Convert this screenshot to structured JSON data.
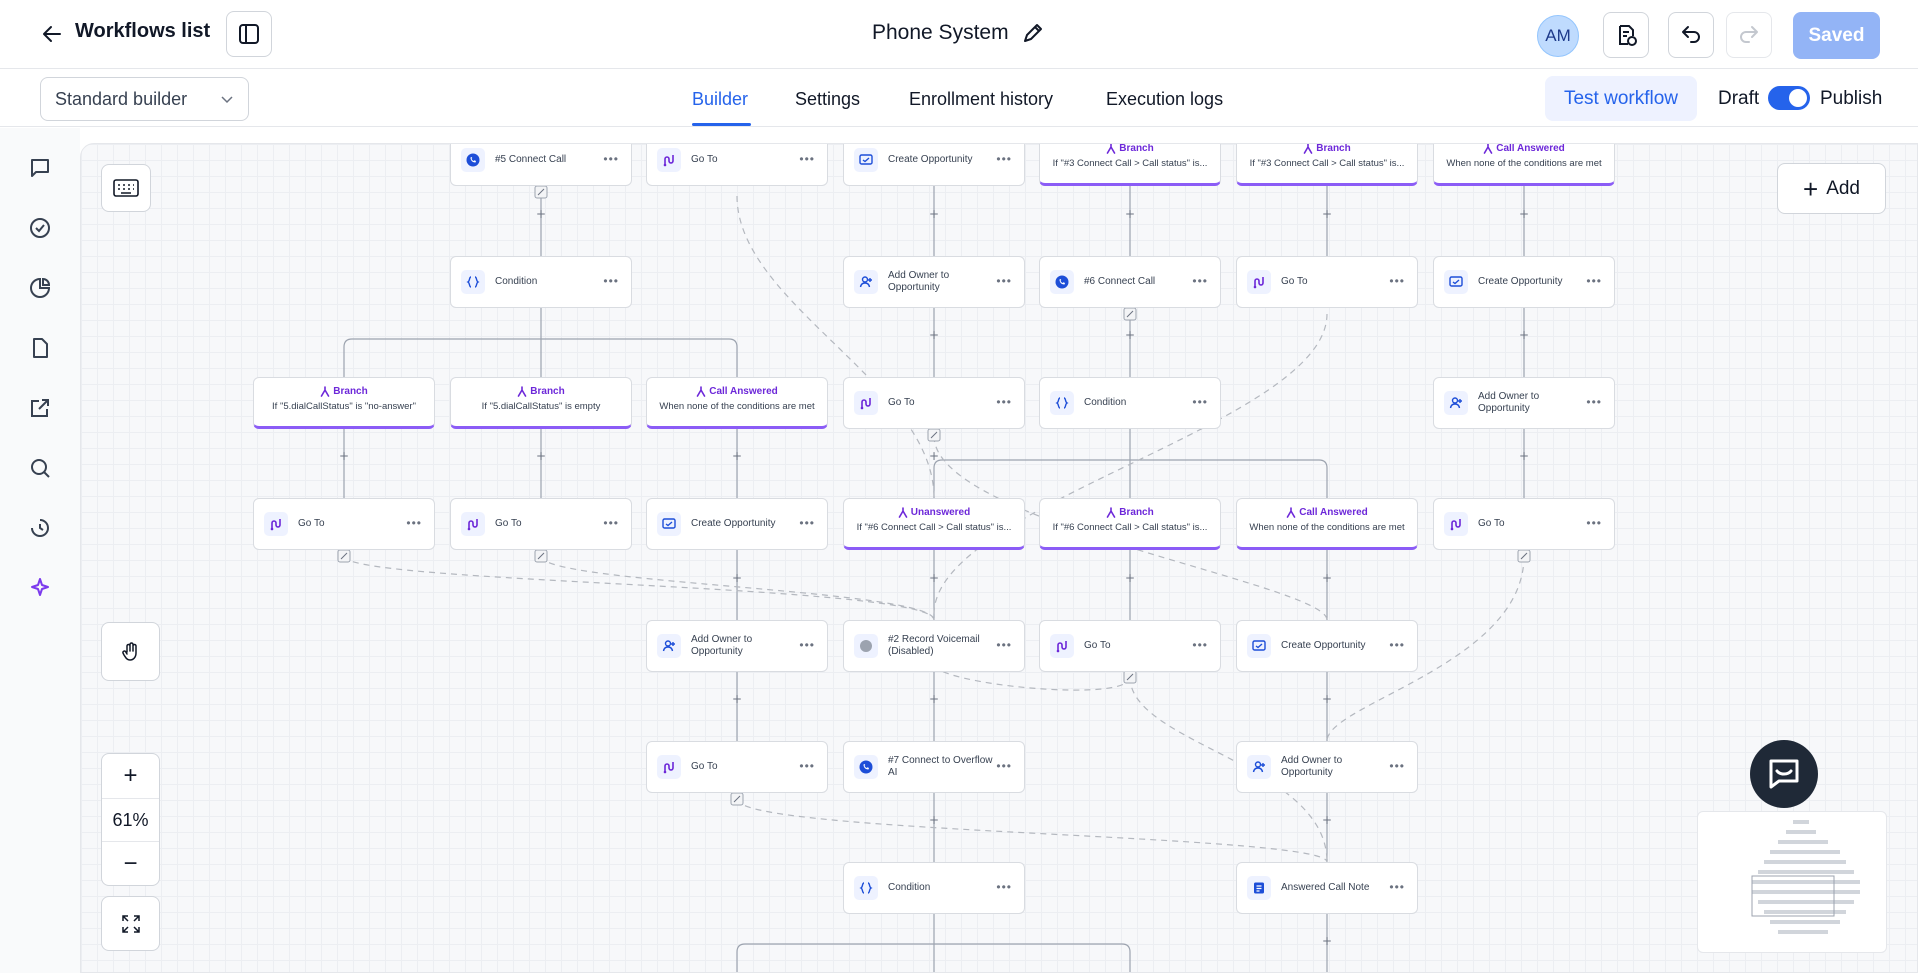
{
  "header": {
    "back_label": "Workflows list",
    "title": "Phone System",
    "avatar_initials": "AM",
    "saved_label": "Saved"
  },
  "subheader": {
    "builder_select": "Standard builder",
    "tabs": [
      "Builder",
      "Settings",
      "Enrollment history",
      "Execution logs"
    ],
    "active_tab": "Builder",
    "test_label": "Test workflow",
    "draft_label": "Draft",
    "publish_label": "Publish",
    "publish_enabled": true
  },
  "sidebar": {
    "icons": [
      "chat-icon",
      "check-circle-icon",
      "pie-chart-icon",
      "document-icon",
      "external-link-icon",
      "search-icon",
      "history-icon",
      "sparkle-icon"
    ]
  },
  "canvas": {
    "add_label": "Add",
    "zoom": "61%",
    "accent": "#8b5cf6",
    "nodes": [
      {
        "t": "action",
        "label": "#5 Connect Call",
        "icon": "phone-icon"
      },
      {
        "t": "action",
        "label": "Go To",
        "icon": "goto-icon"
      },
      {
        "t": "action",
        "label": "Create Opportunity",
        "icon": "opportunity-icon"
      },
      {
        "t": "branch",
        "title": "Branch",
        "sub": "If \"#3 Connect Call > Call status\" is..."
      },
      {
        "t": "branch",
        "title": "Branch",
        "sub": "If \"#3 Connect Call > Call status\" is..."
      },
      {
        "t": "branch",
        "title": "Call Answered",
        "sub": "When none of the conditions are met"
      },
      {
        "t": "action",
        "label": "Condition",
        "icon": "braces-icon"
      },
      {
        "t": "action",
        "label": "Add Owner to Opportunity",
        "icon": "owner-icon"
      },
      {
        "t": "action",
        "label": "#6 Connect Call",
        "icon": "phone-icon"
      },
      {
        "t": "action",
        "label": "Go To",
        "icon": "goto-icon"
      },
      {
        "t": "action",
        "label": "Create Opportunity",
        "icon": "opportunity-icon"
      },
      {
        "t": "branch",
        "title": "Branch",
        "sub": "If \"5.dialCallStatus\" is \"no-answer\""
      },
      {
        "t": "branch",
        "title": "Branch",
        "sub": "If \"5.dialCallStatus\" is empty"
      },
      {
        "t": "branch",
        "title": "Call Answered",
        "sub": "When none of the conditions are met"
      },
      {
        "t": "action",
        "label": "Go To",
        "icon": "goto-icon"
      },
      {
        "t": "action",
        "label": "Condition",
        "icon": "braces-icon"
      },
      {
        "t": "action",
        "label": "Add Owner to Opportunity",
        "icon": "owner-icon"
      },
      {
        "t": "action",
        "label": "Go To",
        "icon": "goto-icon"
      },
      {
        "t": "action",
        "label": "Go To",
        "icon": "goto-icon"
      },
      {
        "t": "action",
        "label": "Create Opportunity",
        "icon": "opportunity-icon"
      },
      {
        "t": "branch",
        "title": "Unanswered",
        "sub": "If \"#6 Connect Call > Call status\" is..."
      },
      {
        "t": "branch",
        "title": "Branch",
        "sub": "If \"#6 Connect Call > Call status\" is..."
      },
      {
        "t": "branch",
        "title": "Call Answered",
        "sub": "When none of the conditions are met"
      },
      {
        "t": "action",
        "label": "Go To",
        "icon": "goto-icon"
      },
      {
        "t": "action",
        "label": "Add Owner to Opportunity",
        "icon": "owner-icon"
      },
      {
        "t": "action",
        "label": "#2 Record Voicemail (Disabled)",
        "icon": "voicemail-icon"
      },
      {
        "t": "action",
        "label": "Go To",
        "icon": "goto-icon"
      },
      {
        "t": "action",
        "label": "Create Opportunity",
        "icon": "opportunity-icon"
      },
      {
        "t": "action",
        "label": "Go To",
        "icon": "goto-icon"
      },
      {
        "t": "action",
        "label": "#7 Connect to Overflow AI",
        "icon": "phone-icon"
      },
      {
        "t": "action",
        "label": "Add Owner to Opportunity",
        "icon": "owner-icon"
      },
      {
        "t": "action",
        "label": "Condition",
        "icon": "braces-icon"
      },
      {
        "t": "action",
        "label": "Answered Call Note",
        "icon": "note-icon"
      }
    ]
  }
}
